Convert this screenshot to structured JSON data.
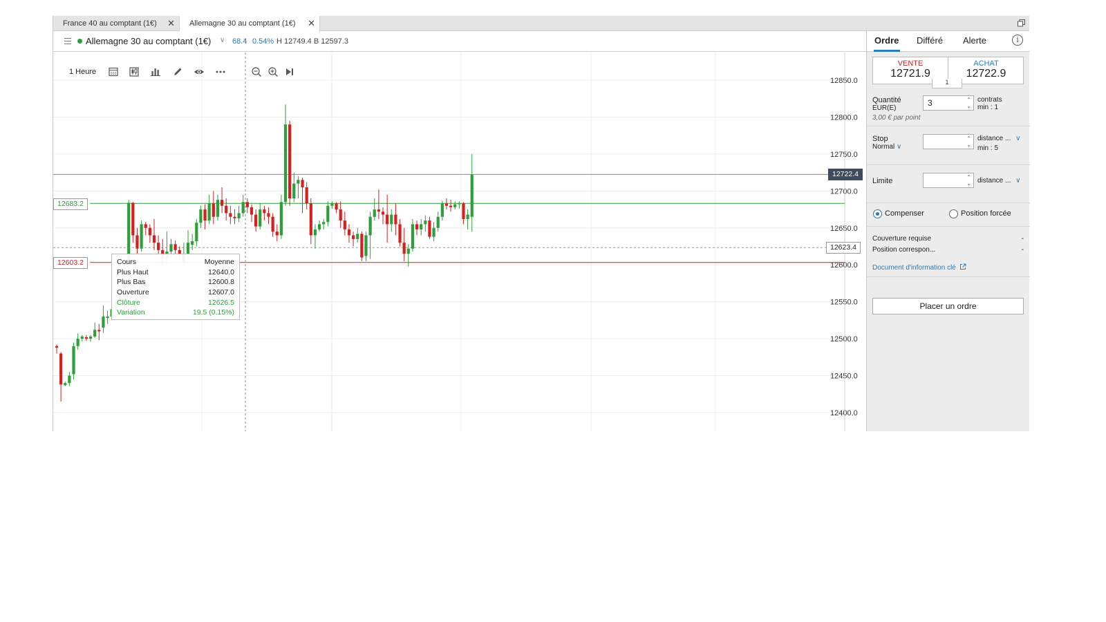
{
  "tabs": [
    {
      "label": "France 40 au comptant (1€)",
      "close": "✕"
    },
    {
      "label": "Allemagne 30 au comptant (1€)",
      "close": "✕"
    }
  ],
  "header": {
    "market": "Allemagne 30 au comptant (1€)",
    "change_points": "68.4",
    "change_pct": "0.54%",
    "high_low": "H 12749.4 B 12597.3",
    "status_color": "#2e9e3a"
  },
  "toolbar": {
    "timeframe": "1 Heure",
    "icons": [
      "calendar-icon",
      "candlestick-icon",
      "bar-chart-icon",
      "draw-pencil-icon",
      "eye-icon",
      "more-icon",
      "zoom-out-icon",
      "zoom-in-icon",
      "jump-to-end-icon"
    ]
  },
  "chart_data": {
    "type": "candlestick",
    "y_ticks": [
      "12850.0",
      "12800.0",
      "12750.0",
      "12700.0",
      "12650.0",
      "12600.0",
      "12550.0",
      "12500.0",
      "12450.0",
      "12400.0"
    ],
    "ylim": [
      12375,
      12865
    ],
    "grid": true,
    "up_color": "#2e9e3a",
    "down_color": "#d42020",
    "current_price_tag": "12722.4",
    "hover_price_tag": "12623.4",
    "level_tags": [
      {
        "label": "12683.2",
        "value": 12683.2,
        "color": "#2e9e3a"
      },
      {
        "label": "12603.2",
        "value": 12603.2,
        "color": "#d42020"
      }
    ],
    "candles": [
      [
        12490,
        12488,
        12480,
        12492
      ],
      [
        12480,
        12438,
        12415,
        12482
      ],
      [
        12437,
        12440,
        12436,
        12442
      ],
      [
        12440,
        12450,
        12436,
        12455
      ],
      [
        12452,
        12490,
        12445,
        12495
      ],
      [
        12490,
        12500,
        12485,
        12507
      ],
      [
        12500,
        12503,
        12496,
        12505
      ],
      [
        12502,
        12500,
        12497,
        12505
      ],
      [
        12500,
        12503,
        12496,
        12505
      ],
      [
        12503,
        12512,
        12501,
        12522
      ],
      [
        12512,
        12510,
        12498,
        12520
      ],
      [
        12515,
        12530,
        12508,
        12545
      ],
      [
        12528,
        12530,
        12520,
        12538
      ],
      [
        12530,
        12540,
        12525,
        12542
      ],
      [
        12540,
        12551,
        12528,
        12560
      ],
      [
        12550,
        12562,
        12545,
        12570
      ],
      [
        12560,
        12580,
        12540,
        12600
      ],
      [
        12600,
        12684,
        12590,
        12688
      ],
      [
        12684,
        12640,
        12630,
        12685
      ],
      [
        12640,
        12622,
        12615,
        12650
      ],
      [
        12622,
        12655,
        12618,
        12660
      ],
      [
        12655,
        12650,
        12640,
        12658
      ],
      [
        12650,
        12640,
        12630,
        12655
      ],
      [
        12640,
        12630,
        12620,
        12662
      ],
      [
        12630,
        12620,
        12610,
        12640
      ],
      [
        12620,
        12608,
        12598,
        12635
      ],
      [
        12608,
        12618,
        12600,
        12645
      ],
      [
        12618,
        12628,
        12610,
        12635
      ],
      [
        12628,
        12620,
        12610,
        12633
      ],
      [
        12620,
        12615,
        12608,
        12625
      ],
      [
        12604,
        12615,
        12600,
        12630
      ],
      [
        12615,
        12630,
        12610,
        12647
      ],
      [
        12627,
        12632,
        12620,
        12642
      ],
      [
        12632,
        12657,
        12625,
        12662
      ],
      [
        12657,
        12675,
        12650,
        12680
      ],
      [
        12675,
        12660,
        12648,
        12682
      ],
      [
        12660,
        12683,
        12655,
        12695
      ],
      [
        12683,
        12665,
        12655,
        12700
      ],
      [
        12665,
        12688,
        12660,
        12695
      ],
      [
        12688,
        12680,
        12670,
        12705
      ],
      [
        12680,
        12670,
        12660,
        12690
      ],
      [
        12670,
        12665,
        12655,
        12680
      ],
      [
        12665,
        12663,
        12655,
        12675
      ],
      [
        12663,
        12670,
        12658,
        12680
      ],
      [
        12670,
        12685,
        12665,
        12695
      ],
      [
        12685,
        12678,
        12670,
        12690
      ],
      [
        12678,
        12668,
        12658,
        12682
      ],
      [
        12668,
        12652,
        12645,
        12675
      ],
      [
        12652,
        12675,
        12648,
        12683
      ],
      [
        12675,
        12670,
        12660,
        12680
      ],
      [
        12670,
        12665,
        12655,
        12678
      ],
      [
        12665,
        12645,
        12638,
        12670
      ],
      [
        12645,
        12640,
        12632,
        12655
      ],
      [
        12640,
        12685,
        12635,
        12695
      ],
      [
        12685,
        12790,
        12680,
        12817
      ],
      [
        12790,
        12690,
        12680,
        12795
      ],
      [
        12690,
        12710,
        12685,
        12725
      ],
      [
        12710,
        12715,
        12690,
        12720
      ],
      [
        12715,
        12705,
        12670,
        12718
      ],
      [
        12705,
        12683,
        12675,
        12712
      ],
      [
        12683,
        12640,
        12628,
        12690
      ],
      [
        12640,
        12648,
        12622,
        12655
      ],
      [
        12648,
        12655,
        12645,
        12660
      ],
      [
        12655,
        12658,
        12648,
        12662
      ],
      [
        12658,
        12680,
        12652,
        12686
      ],
      [
        12680,
        12683,
        12676,
        12686
      ],
      [
        12683,
        12675,
        12670,
        12685
      ],
      [
        12675,
        12660,
        12650,
        12686
      ],
      [
        12660,
        12648,
        12640,
        12672
      ],
      [
        12648,
        12640,
        12630,
        12655
      ],
      [
        12640,
        12635,
        12625,
        12645
      ],
      [
        12635,
        12642,
        12630,
        12650
      ],
      [
        12642,
        12610,
        12605,
        12645
      ],
      [
        12612,
        12640,
        12605,
        12645
      ],
      [
        12640,
        12665,
        12608,
        12672
      ],
      [
        12665,
        12675,
        12660,
        12690
      ],
      [
        12675,
        12672,
        12662,
        12702
      ],
      [
        12672,
        12668,
        12655,
        12678
      ],
      [
        12668,
        12655,
        12630,
        12695
      ],
      [
        12655,
        12668,
        12645,
        12675
      ],
      [
        12668,
        12655,
        12640,
        12683
      ],
      [
        12655,
        12630,
        12625,
        12662
      ],
      [
        12630,
        12615,
        12605,
        12650
      ],
      [
        12615,
        12622,
        12598,
        12628
      ],
      [
        12622,
        12655,
        12618,
        12662
      ],
      [
        12655,
        12648,
        12640,
        12660
      ],
      [
        12648,
        12655,
        12640,
        12662
      ],
      [
        12655,
        12660,
        12645,
        12667
      ],
      [
        12660,
        12638,
        12635,
        12665
      ],
      [
        12638,
        12650,
        12632,
        12658
      ],
      [
        12650,
        12665,
        12645,
        12672
      ],
      [
        12665,
        12683,
        12660,
        12687
      ],
      [
        12683,
        12680,
        12675,
        12690
      ],
      [
        12680,
        12678,
        12672,
        12688
      ],
      [
        12678,
        12682,
        12675,
        12686
      ],
      [
        12682,
        12683,
        12676,
        12686
      ],
      [
        12683,
        12662,
        12655,
        12685
      ],
      [
        12662,
        12668,
        12648,
        12675
      ],
      [
        12665,
        12722,
        12645,
        12750
      ]
    ]
  },
  "tooltip": {
    "rows": [
      {
        "label": "Cours",
        "value": "Moyenne"
      },
      {
        "label": "Plus Haut",
        "value": "12640.0"
      },
      {
        "label": "Plus Bas",
        "value": "12600.8"
      },
      {
        "label": "Ouverture",
        "value": "12607.0"
      },
      {
        "label": "Clôture",
        "value": "12626.5"
      },
      {
        "label": "Variation",
        "value": "19.5 (0.15%)"
      }
    ]
  },
  "panel": {
    "tabs": [
      "Ordre",
      "Différé",
      "Alerte"
    ],
    "sell_label": "VENTE",
    "sell_price": "12721.9",
    "buy_label": "ACHAT",
    "buy_price": "12722.9",
    "spread": "1",
    "quantity_label": "Quantité",
    "currency": "EUR(E)",
    "quantity_value": "3",
    "quantity_unit": "contrats",
    "quantity_min": "min : 1",
    "per_point": "3,00 € par point",
    "stop_label": "Stop",
    "stop_type": "Normal",
    "stop_distance": "distance ...",
    "stop_min": "min : 5",
    "limit_label": "Limite",
    "limit_distance": "distance ...",
    "radio_compenser": "Compenser",
    "radio_forcee": "Position forcée",
    "cover_label": "Couverture requise",
    "cover_value": "-",
    "position_label": "Position correspon...",
    "position_value": "-",
    "doc_link": "Document d'information clé",
    "place_order": "Placer un ordre"
  }
}
